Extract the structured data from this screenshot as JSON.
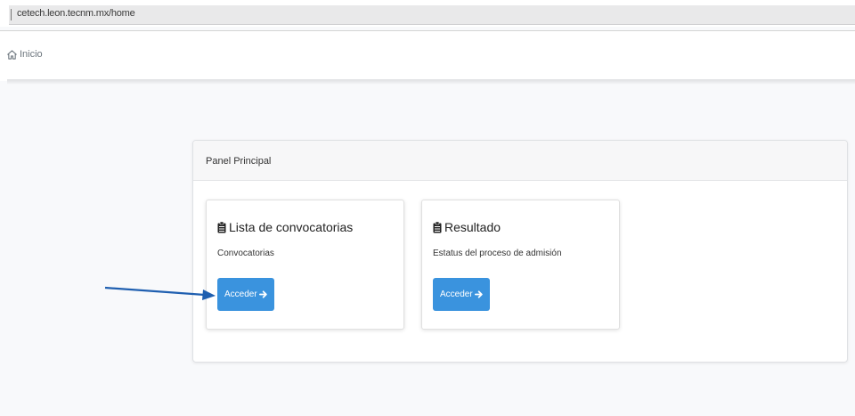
{
  "browser": {
    "url": "cetech.leon.tecnm.mx/home"
  },
  "nav": {
    "home_label": "Inicio"
  },
  "panel": {
    "title": "Panel Principal",
    "cards": [
      {
        "title": "Lista de convocatorias",
        "subtitle": "Convocatorias",
        "button": "Acceder"
      },
      {
        "title": "Resultado",
        "subtitle": "Estatus del proceso de admisión",
        "button": "Acceder"
      }
    ]
  },
  "colors": {
    "primary_button": "#3a93de",
    "annotation_arrow": "#1f5fb0"
  },
  "icons": {
    "home": "home-icon",
    "card": "clipboard-icon",
    "button": "arrow-right-icon"
  }
}
